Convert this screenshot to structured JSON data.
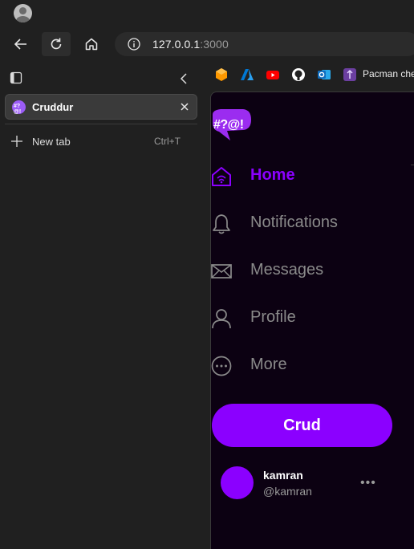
{
  "browser": {
    "url_host": "127.0.0.1",
    "url_port": ":3000"
  },
  "sidebar": {
    "active_tab": {
      "title": "Cruddur",
      "favicon_text": "#?@!"
    },
    "new_tab": {
      "label": "New tab",
      "shortcut": "Ctrl+T"
    }
  },
  "bookmarks": {
    "items": [
      {
        "icon": "aws-icon",
        "color": "#ff9900"
      },
      {
        "icon": "azure-icon",
        "color": "#0078d4"
      },
      {
        "icon": "youtube-icon",
        "color": "#ff0000"
      },
      {
        "icon": "github-icon",
        "color": "#ffffff"
      },
      {
        "icon": "outlook-icon",
        "color": "#0f6cbd"
      },
      {
        "icon": "bookmark-app-icon",
        "color": "#6b3fa0"
      }
    ],
    "last_label": "Pacman che"
  },
  "app": {
    "logo_text": "#?@!",
    "nav": [
      {
        "label": "Home",
        "icon": "home-icon",
        "active": true
      },
      {
        "label": "Notifications",
        "icon": "bell-icon"
      },
      {
        "label": "Messages",
        "icon": "envelope-icon"
      },
      {
        "label": "Profile",
        "icon": "person-icon"
      },
      {
        "label": "More",
        "icon": "more-circle-icon"
      }
    ],
    "crud_button": "Crud",
    "user": {
      "name": "kamran",
      "handle": "@kamran",
      "more": "•••"
    },
    "accent": "#8b00ff"
  }
}
